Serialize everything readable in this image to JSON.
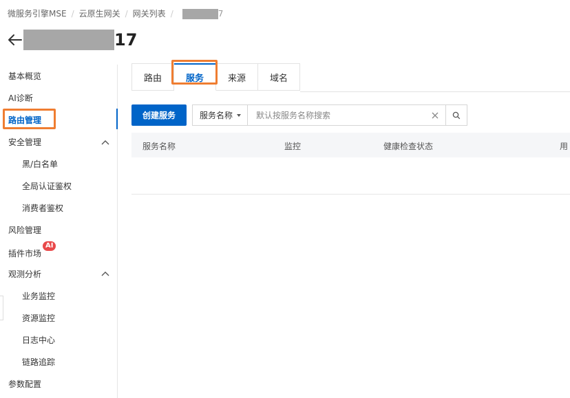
{
  "breadcrumb": {
    "items": [
      "微服务引擎MSE",
      "云原生网关",
      "网关列表"
    ],
    "current_suffix": "7"
  },
  "page": {
    "title_suffix": "17"
  },
  "sidebar": {
    "items": [
      {
        "label": "基本概览"
      },
      {
        "label": "AI诊断"
      },
      {
        "label": "路由管理"
      },
      {
        "label": "安全管理"
      },
      {
        "label": "黑/白名单"
      },
      {
        "label": "全局认证鉴权"
      },
      {
        "label": "消费者鉴权"
      },
      {
        "label": "风险管理"
      },
      {
        "label": "插件市场"
      },
      {
        "label": "观测分析"
      },
      {
        "label": "业务监控"
      },
      {
        "label": "资源监控"
      },
      {
        "label": "日志中心"
      },
      {
        "label": "链路追踪"
      },
      {
        "label": "参数配置"
      }
    ],
    "ai_badge": "AI"
  },
  "tabs": [
    {
      "label": "路由"
    },
    {
      "label": "服务"
    },
    {
      "label": "来源"
    },
    {
      "label": "域名"
    }
  ],
  "toolbar": {
    "create_label": "创建服务",
    "filter_select": "服务名称",
    "search_placeholder": "默认按服务名称搜索"
  },
  "table": {
    "columns": [
      "服务名称",
      "监控",
      "健康检查状态",
      "用"
    ]
  },
  "colors": {
    "accent": "#0064c8",
    "highlight": "#ef7d31",
    "badge": "#e9494a"
  }
}
